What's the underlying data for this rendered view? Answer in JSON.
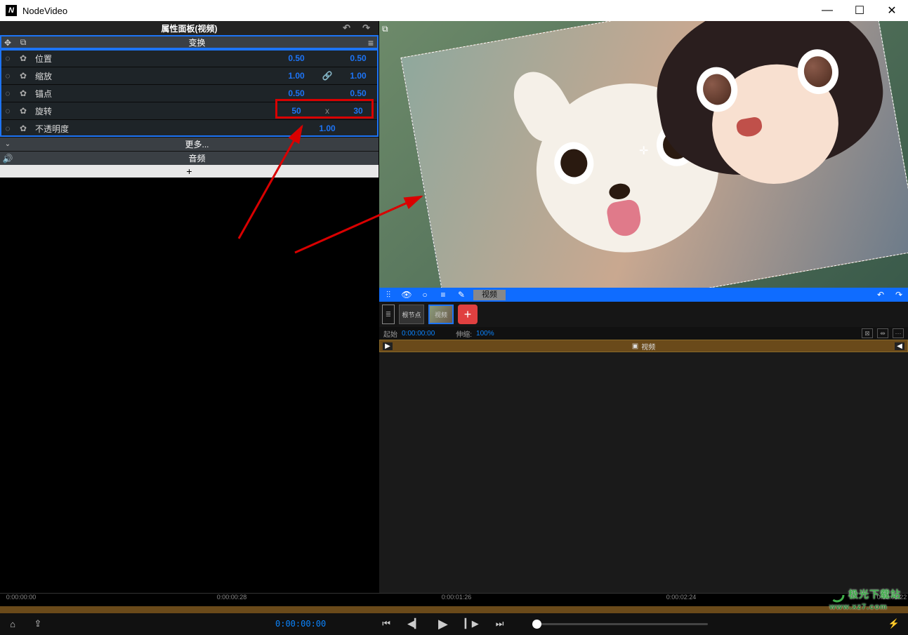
{
  "app": {
    "title": "NodeVideo"
  },
  "window": {
    "min": "—",
    "max": "☐",
    "close": "✕"
  },
  "panel": {
    "title": "属性面板(视频)",
    "undo": "↶",
    "redo": "↷",
    "transform_header": "变换",
    "props": {
      "position": {
        "label": "位置",
        "x": "0.50",
        "y": "0.50"
      },
      "scale": {
        "label": "缩放",
        "x": "1.00",
        "link": "🔗",
        "y": "1.00"
      },
      "anchor": {
        "label": "锚点",
        "x": "0.50",
        "y": "0.50"
      },
      "rotation": {
        "label": "旋转",
        "x": "50",
        "mid": "x",
        "y": "30"
      },
      "opacity": {
        "label": "不透明度",
        "val": "1.00"
      }
    },
    "more": "更多...",
    "audio": "音频",
    "add": "+"
  },
  "toolbar": {
    "hierarchy": "⫶⫶",
    "eye": "👁",
    "circle": "○",
    "menu": "≡",
    "pen": "✎",
    "field": "视频",
    "undo": "↶",
    "redo": "↷"
  },
  "thumbs": {
    "doc": "≣",
    "root": "根节点",
    "video_sel": "视频",
    "add": "+"
  },
  "info": {
    "start_label": "起始",
    "start_val": "0:00:00:00",
    "stretch_label": "伸缩:",
    "stretch_val": "100%",
    "sq1": "⊠",
    "sq2": "⇹",
    "sq3": "⋯"
  },
  "track": {
    "label": "视频",
    "icon": "▣"
  },
  "ruler": {
    "ticks": [
      "0:00:00:00",
      "0:00:00:28",
      "0:00:01:26",
      "0:00:02:24",
      "0:00:03:22"
    ]
  },
  "bottom": {
    "home": "⌂",
    "share": "⇪",
    "time": "0:00:00:00",
    "prev_kf": "⏮",
    "prev": "◀▎",
    "play": "▶",
    "next": "▎▶",
    "next_kf": "⏭",
    "flash": "⚡"
  },
  "watermark": {
    "brand": "极光下载站",
    "url": "www.xz7.com"
  }
}
